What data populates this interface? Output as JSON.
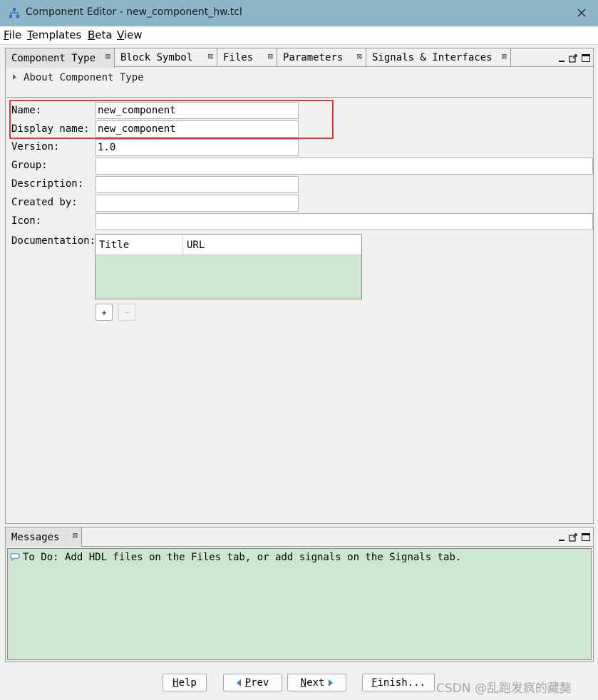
{
  "window": {
    "title": "Component Editor - new_component_hw.tcl",
    "app_icon": "hierarchy-icon",
    "close_icon": "close-icon"
  },
  "menu": [
    {
      "accel": "F",
      "rest": "ile"
    },
    {
      "accel": "T",
      "rest": "emplates"
    },
    {
      "accel": "B",
      "rest": "eta"
    },
    {
      "accel": "V",
      "rest": "iew"
    }
  ],
  "tabs": [
    {
      "label": "Component Type",
      "active": true
    },
    {
      "label": "Block Symbol",
      "active": false
    },
    {
      "label": "Files",
      "active": false
    },
    {
      "label": "Parameters",
      "active": false
    },
    {
      "label": "Signals & Interfaces",
      "active": false
    }
  ],
  "tab_close_glyph": "⊠",
  "about_label": "About Component Type",
  "form": {
    "name": {
      "label": "Name:",
      "value": "new_component"
    },
    "display_name": {
      "label": "Display name:",
      "value": "new_component"
    },
    "version": {
      "label": "Version:",
      "value": "1.0"
    },
    "group": {
      "label": "Group:",
      "value": ""
    },
    "description": {
      "label": "Description:",
      "value": ""
    },
    "created_by": {
      "label": "Created by:",
      "value": ""
    },
    "icon": {
      "label": "Icon:",
      "value": ""
    },
    "documentation": {
      "label": "Documentation:",
      "columns": [
        "Title",
        "URL"
      ]
    }
  },
  "doc_buttons": {
    "add": "+",
    "remove": "−"
  },
  "messages": {
    "tab_label": "Messages",
    "text": "To Do: Add HDL files on the Files tab, or add signals on the Signals tab."
  },
  "footer": {
    "help": {
      "accel": "H",
      "rest": "elp"
    },
    "prev": {
      "accel": "P",
      "rest": "rev"
    },
    "next": {
      "accel": "N",
      "rest": "ext"
    },
    "finish": {
      "accel": "F",
      "rest": "inish..."
    }
  },
  "watermark": "CSDN @乱跑发疯的藏獒",
  "colors": {
    "titlebar": "#8db5c8",
    "highlight": "#e03b3b",
    "doc_table_bg": "#cde6cf",
    "arrow_blue": "#3b78d4"
  }
}
